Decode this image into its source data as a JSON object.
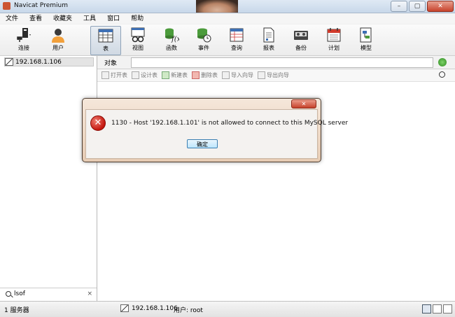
{
  "window": {
    "title": "Navicat Premium",
    "min": "–",
    "max": "▢",
    "close": "✕"
  },
  "menu": [
    "文件",
    "查看",
    "收藏夹",
    "工具",
    "窗口",
    "帮助"
  ],
  "toolbar": {
    "connect": "连接",
    "user": "用户",
    "table": "表",
    "view": "视图",
    "function": "函数",
    "event": "事件",
    "query": "查询",
    "report": "报表",
    "backup": "备份",
    "schedule": "计划",
    "model": "模型"
  },
  "tree": {
    "connection": "192.168.1.106"
  },
  "search": {
    "query": "lsof",
    "clear": "×"
  },
  "objects": {
    "tab": "对象",
    "actions": [
      "打开表",
      "设计表",
      "新建表",
      "删除表",
      "导入向导",
      "导出向导"
    ]
  },
  "dialog": {
    "close": "✕",
    "message": "1130 - Host '192.168.1.101' is not allowed to connect to this MySQL server",
    "ok": "确定"
  },
  "status": {
    "servers": "1 服务器",
    "connection": "192.168.1.106",
    "user": "用户: root"
  },
  "colors": {
    "accent": "#3c7fb1",
    "error": "#c4160e"
  }
}
